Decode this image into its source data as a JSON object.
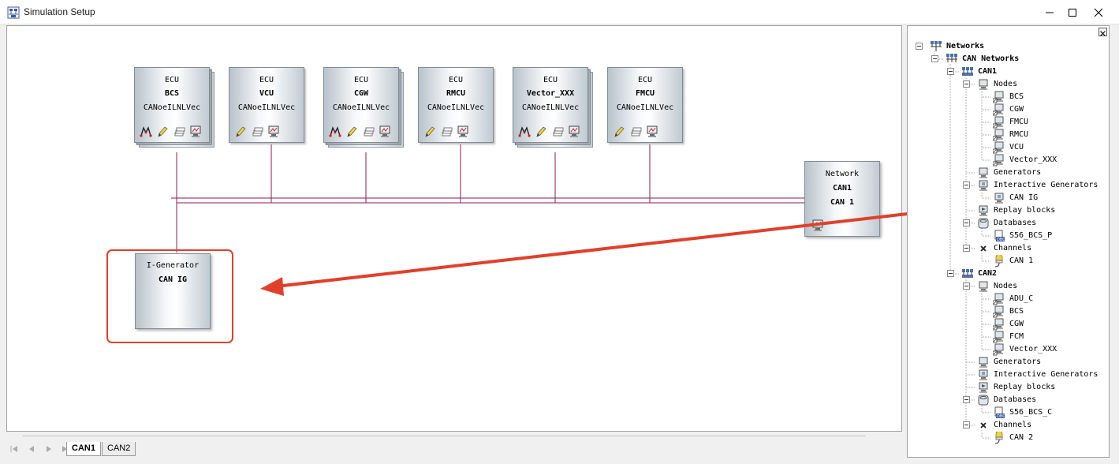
{
  "window": {
    "title": "Simulation Setup"
  },
  "ecus": [
    {
      "kind": "ECU",
      "name": "BCS",
      "sub": "CANoeILNLVec",
      "icons": [
        "network-access-icon",
        "edit-pencil-icon",
        "stack-icon",
        "monitor-icon"
      ]
    },
    {
      "kind": "ECU",
      "name": "VCU",
      "sub": "CANoeILNLVec",
      "icons": [
        "edit-pencil-icon",
        "stack-icon",
        "monitor-icon"
      ]
    },
    {
      "kind": "ECU",
      "name": "CGW",
      "sub": "CANoeILNLVec",
      "icons": [
        "network-access-icon",
        "edit-pencil-icon",
        "stack-icon",
        "monitor-icon"
      ]
    },
    {
      "kind": "ECU",
      "name": "RMCU",
      "sub": "CANoeILNLVec",
      "icons": [
        "edit-pencil-icon",
        "stack-icon",
        "monitor-icon"
      ]
    },
    {
      "kind": "ECU",
      "name": "Vector_XXX",
      "sub": "CANoeILNLVec",
      "icons": [
        "network-access-icon",
        "edit-pencil-icon",
        "stack-icon",
        "monitor-icon"
      ]
    },
    {
      "kind": "ECU",
      "name": "FMCU",
      "sub": "CANoeILNLVec",
      "icons": [
        "edit-pencil-icon",
        "stack-icon",
        "monitor-icon"
      ]
    }
  ],
  "network_block": {
    "kind": "Network",
    "name": "CAN1",
    "sub": "CAN 1"
  },
  "igen_block": {
    "kind": "I-Generator",
    "name": "CAN IG"
  },
  "tabs": [
    {
      "label": "CAN1",
      "active": true
    },
    {
      "label": "CAN2",
      "active": false
    }
  ],
  "tree": [
    {
      "label": "Networks",
      "bold": true,
      "icon": "networks-icon",
      "expand": true
    },
    {
      "label": "CAN Networks",
      "bold": true,
      "icon": "can-networks-icon",
      "expand": true
    },
    {
      "label": "CAN1",
      "bold": true,
      "icon": "bus-icon",
      "expand": true
    },
    {
      "label": "Nodes",
      "bold": false,
      "icon": "nodes-icon",
      "expand": true
    },
    {
      "label": "BCS",
      "bold": false,
      "icon": "node-icon",
      "expand": false
    },
    {
      "label": "CGW",
      "bold": false,
      "icon": "node-icon",
      "expand": false
    },
    {
      "label": "FMCU",
      "bold": false,
      "icon": "node-icon",
      "expand": false
    },
    {
      "label": "RMCU",
      "bold": false,
      "icon": "node-icon",
      "expand": false
    },
    {
      "label": "VCU",
      "bold": false,
      "icon": "node-icon",
      "expand": false
    },
    {
      "label": "Vector_XXX",
      "bold": false,
      "icon": "node-icon",
      "expand": false
    },
    {
      "label": "Generators",
      "bold": false,
      "icon": "generators-icon",
      "expand": false
    },
    {
      "label": "Interactive Generators",
      "bold": false,
      "icon": "interactive-generators-icon",
      "expand": true
    },
    {
      "label": "CAN IG",
      "bold": false,
      "icon": "generator-icon",
      "expand": false
    },
    {
      "label": "Replay blocks",
      "bold": false,
      "icon": "replay-blocks-icon",
      "expand": false
    },
    {
      "label": "Databases",
      "bold": false,
      "icon": "databases-icon",
      "expand": true
    },
    {
      "label": "S56_BCS_P",
      "bold": false,
      "icon": "database-file-icon",
      "expand": false
    },
    {
      "label": "Channels",
      "bold": false,
      "icon": "channels-icon",
      "expand": true
    },
    {
      "label": "CAN 1",
      "bold": false,
      "icon": "channel-icon",
      "expand": false
    },
    {
      "label": "CAN2",
      "bold": true,
      "icon": "bus-icon",
      "expand": true
    },
    {
      "label": "Nodes",
      "bold": false,
      "icon": "nodes-icon",
      "expand": true
    },
    {
      "label": "ADU_C",
      "bold": false,
      "icon": "node-icon",
      "expand": false
    },
    {
      "label": "BCS",
      "bold": false,
      "icon": "node-icon",
      "expand": false
    },
    {
      "label": "CGW",
      "bold": false,
      "icon": "node-icon",
      "expand": false
    },
    {
      "label": "FCM",
      "bold": false,
      "icon": "node-icon",
      "expand": false
    },
    {
      "label": "Vector_XXX",
      "bold": false,
      "icon": "node-icon",
      "expand": false
    },
    {
      "label": "Generators",
      "bold": false,
      "icon": "generators-icon",
      "expand": false
    },
    {
      "label": "Interactive Generators",
      "bold": false,
      "icon": "interactive-generators-icon",
      "expand": false
    },
    {
      "label": "Replay blocks",
      "bold": false,
      "icon": "replay-blocks-icon",
      "expand": false
    },
    {
      "label": "Databases",
      "bold": false,
      "icon": "databases-icon",
      "expand": true
    },
    {
      "label": "S56_BCS_C",
      "bold": false,
      "icon": "database-file-icon",
      "expand": false
    },
    {
      "label": "Channels",
      "bold": false,
      "icon": "channels-icon",
      "expand": true
    },
    {
      "label": "CAN 2",
      "bold": false,
      "icon": "channel-icon",
      "expand": false
    }
  ],
  "colors": {
    "bus": "#8b1a54",
    "annotation": "#e0402a",
    "accent": "#1f3f8f"
  }
}
